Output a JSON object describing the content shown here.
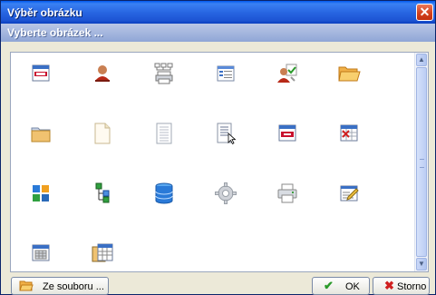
{
  "window": {
    "title": "Výběr obrázku"
  },
  "header": {
    "title": "Vyberte obrázek ..."
  },
  "icons": [
    [
      "window-calendar-icon",
      "user-icon",
      "network-printer-icon",
      "list-document-icon",
      "user-check-icon",
      "folder-open-icon"
    ],
    [
      "folder-icon",
      "blank-page-icon",
      "lined-page-icon",
      "page-pointer-icon",
      "window-red-icon",
      "grid-delete-icon"
    ],
    [
      "windows-logo-icon",
      "tree-structure-icon",
      "database-icon",
      "gear-icon",
      "printer-icon",
      "edit-window-icon"
    ],
    [
      "calendar-window-icon",
      "table-window-icon"
    ]
  ],
  "footer": {
    "from_file_label": "Ze souboru ...",
    "ok_label": "OK",
    "cancel_label": "Storno"
  },
  "colors": {
    "title_bar": "#2663e0",
    "header_bar": "#9eb1db",
    "accent_red": "#c8102e"
  }
}
